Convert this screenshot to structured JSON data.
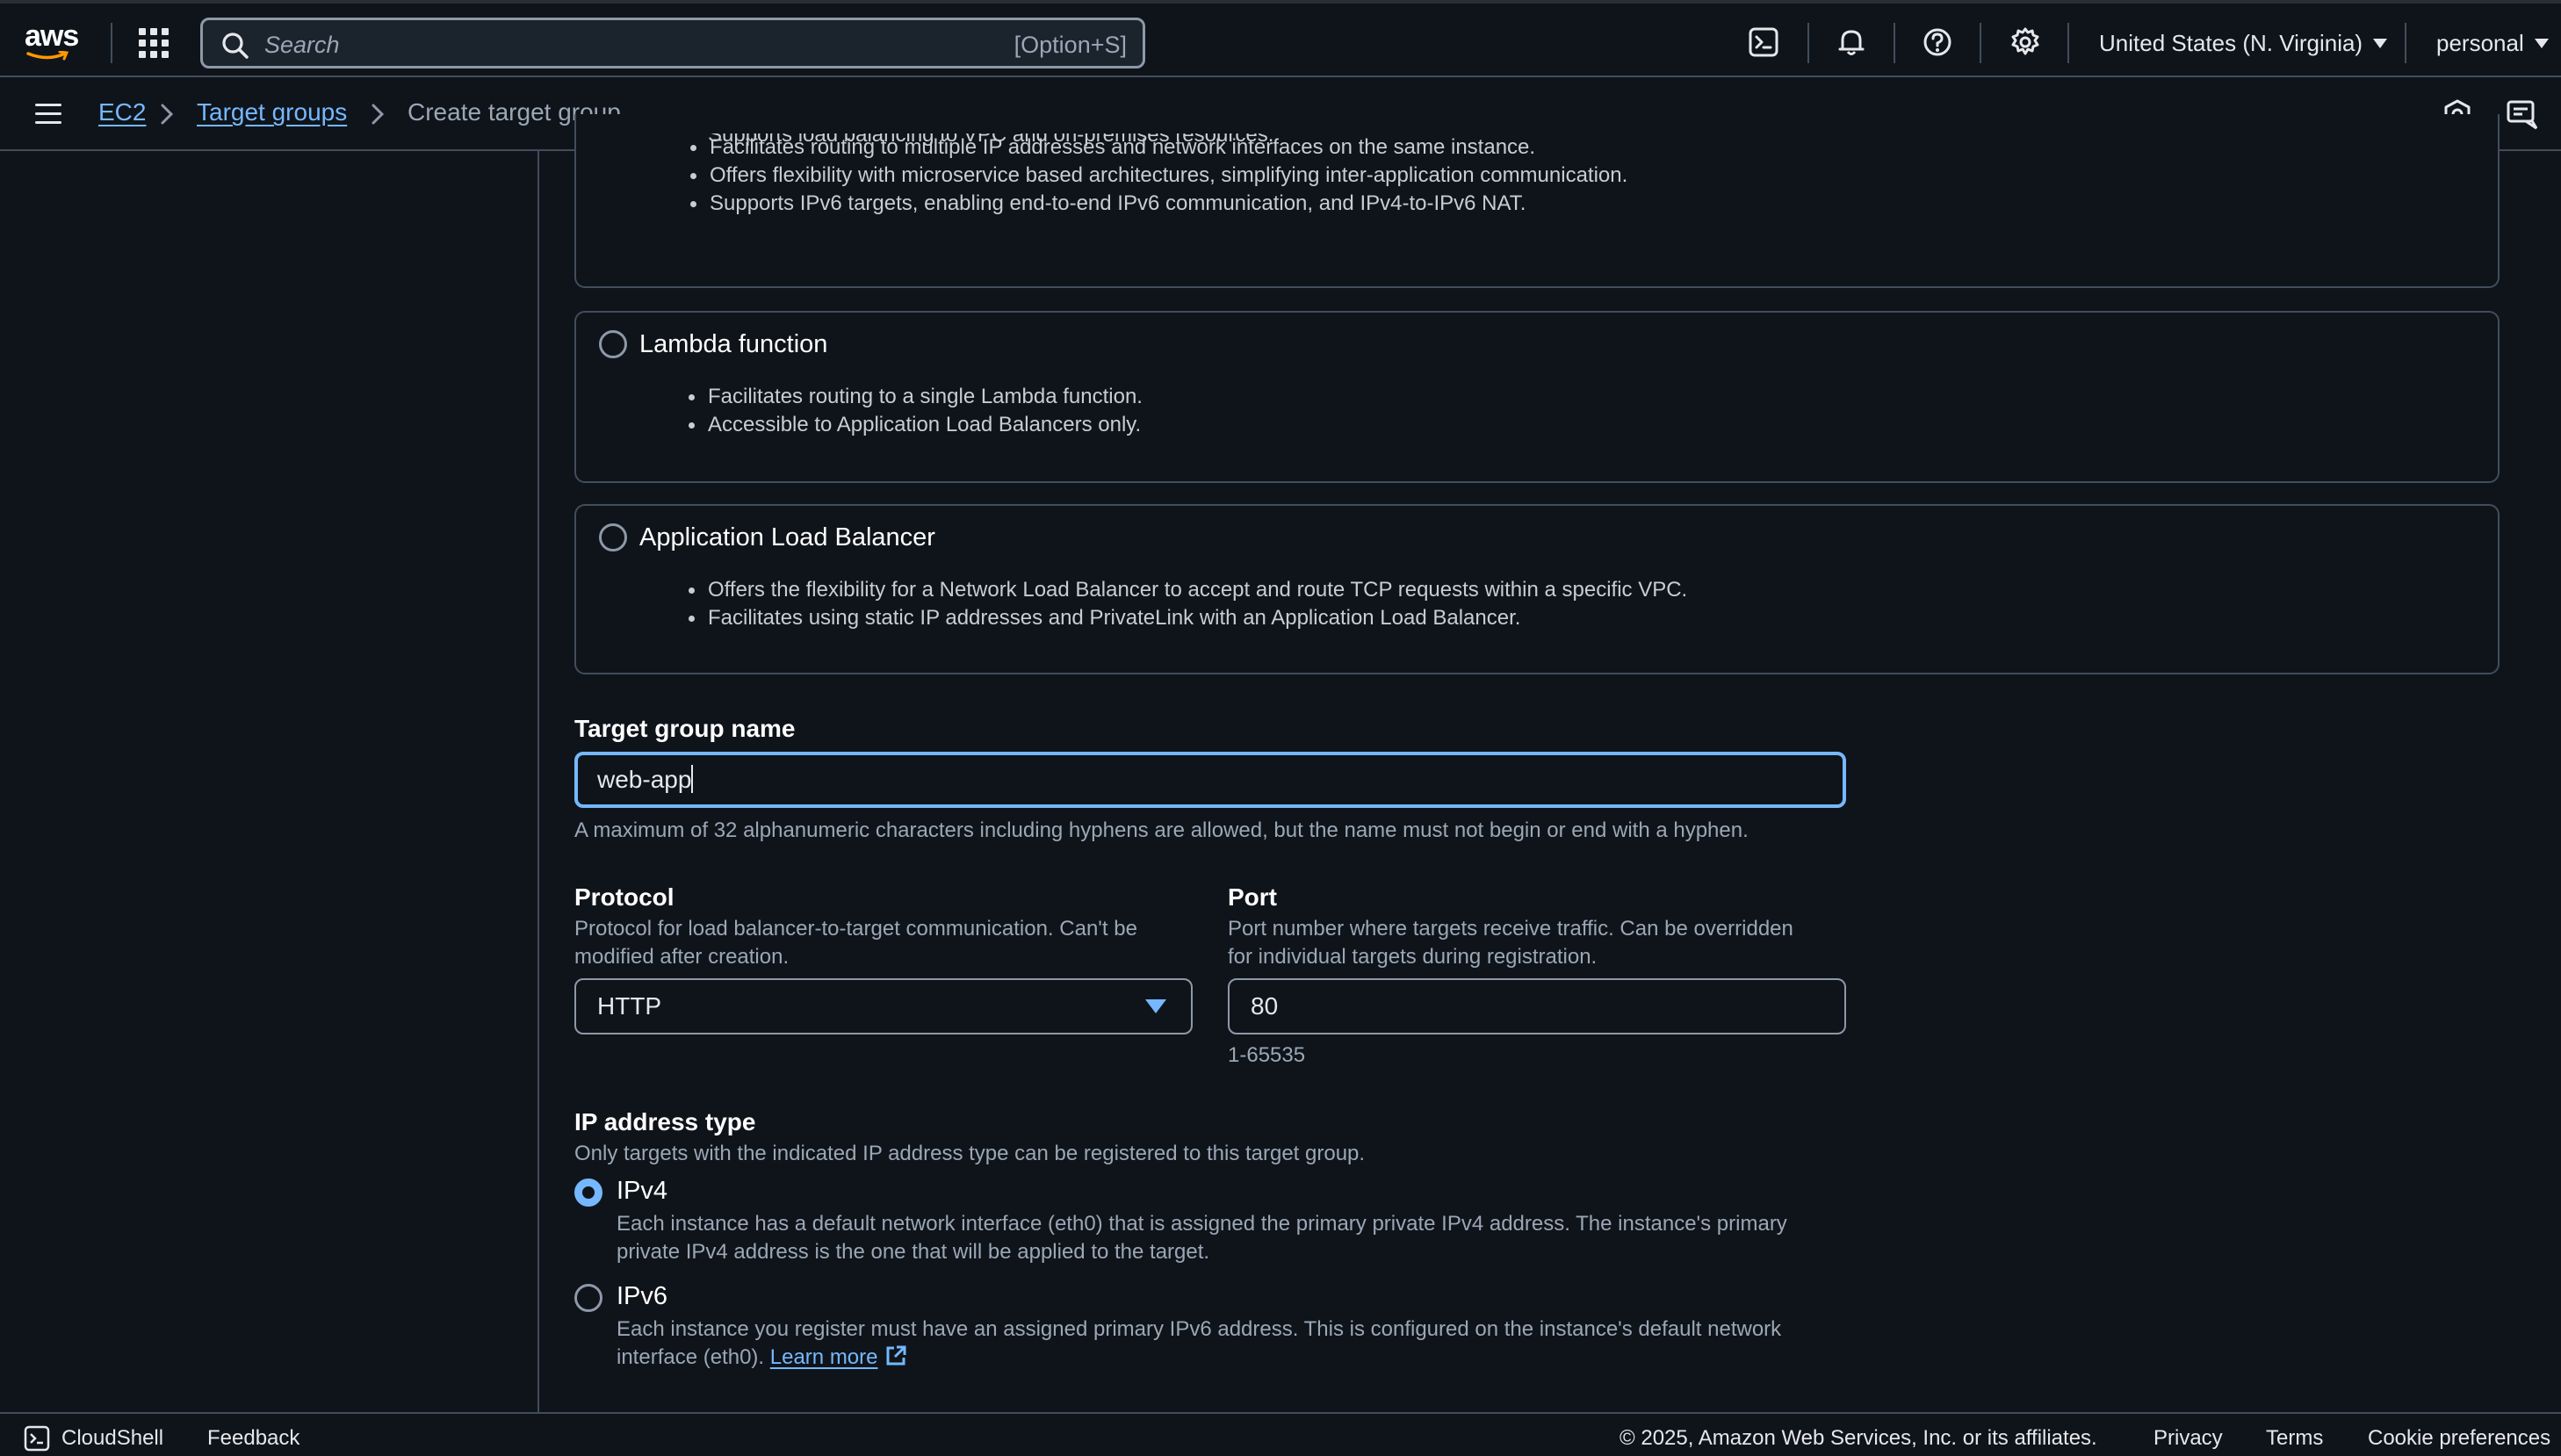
{
  "topnav": {
    "logo_text": "aws",
    "search_placeholder": "Search",
    "search_shortcut": "[Option+S]",
    "region": "United States (N. Virginia)",
    "profile": "personal",
    "icons": [
      "cloudshell-icon",
      "bell-icon",
      "help-icon",
      "gear-icon"
    ]
  },
  "breadcrumb": {
    "items": [
      {
        "label": "EC2"
      },
      {
        "label": "Target groups"
      },
      {
        "label": "Create target group"
      }
    ]
  },
  "target_types": [
    {
      "title": "",
      "bullets": [
        "Supports load balancing to VPC and on-premises resources.",
        "Facilitates routing to multiple IP addresses and network interfaces on the same instance.",
        "Offers flexibility with microservice based architectures, simplifying inter-application communication.",
        "Supports IPv6 targets, enabling end-to-end IPv6 communication, and IPv4-to-IPv6 NAT."
      ]
    },
    {
      "title": "Lambda function",
      "bullets": [
        "Facilitates routing to a single Lambda function.",
        "Accessible to Application Load Balancers only."
      ]
    },
    {
      "title": "Application Load Balancer",
      "bullets": [
        "Offers the flexibility for a Network Load Balancer to accept and route TCP requests within a specific VPC.",
        "Facilitates using static IP addresses and PrivateLink with an Application Load Balancer."
      ]
    }
  ],
  "target_group_name": {
    "label": "Target group name",
    "value": "web-app",
    "hint": "A maximum of 32 alphanumeric characters including hyphens are allowed, but the name must not begin or end with a hyphen."
  },
  "protocol": {
    "label": "Protocol",
    "desc_line1": "Protocol for load balancer-to-target communication. Can't be",
    "desc_line2": "modified after creation.",
    "value": "HTTP"
  },
  "port": {
    "label": "Port",
    "desc_line1": "Port number where targets receive traffic. Can be overridden",
    "desc_line2": "for individual targets during registration.",
    "value": "80",
    "hint": "1-65535"
  },
  "ip_type": {
    "label": "IP address type",
    "desc": "Only targets with the indicated IP address type can be registered to this target group.",
    "options": [
      {
        "label": "IPv4",
        "selected": true,
        "desc_line1": "Each instance has a default network interface (eth0) that is assigned the primary private IPv4 address. The instance's primary",
        "desc_line2": "private IPv4 address is the one that will be applied to the target."
      },
      {
        "label": "IPv6",
        "selected": false,
        "desc_line1": "Each instance you register must have an assigned primary IPv6 address. This is configured on the instance's default network",
        "desc_line2": "interface (eth0).",
        "link": "Learn more"
      }
    ]
  },
  "footer": {
    "cloudshell": "CloudShell",
    "feedback": "Feedback",
    "copyright": "© 2025, Amazon Web Services, Inc. or its affiliates.",
    "privacy": "Privacy",
    "terms": "Terms",
    "cookies": "Cookie preferences"
  },
  "colors": {
    "background": "#0f141a",
    "accent": "#75b8ff",
    "border": "#414d5c"
  }
}
